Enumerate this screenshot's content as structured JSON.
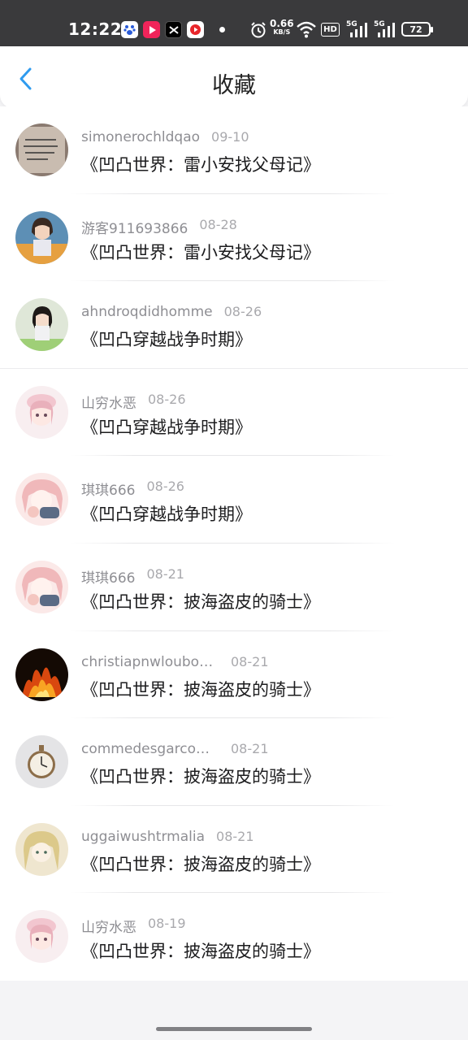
{
  "status_bar": {
    "time": "12:22",
    "net_speed_value": "0.66",
    "net_speed_unit": "KB/S",
    "hd_label": "HD",
    "sim1_label": "5G",
    "sim2_label": "5G",
    "battery": "72"
  },
  "header": {
    "title": "收藏",
    "back_icon": "chevron-left-icon",
    "accent_color": "#2f9bef"
  },
  "favorites": [
    {
      "user": "simonerochldqao",
      "date": "09-10",
      "work": "《凹凸世界：雷小安找父母记》"
    },
    {
      "user": "游客911693866",
      "date": "08-28",
      "work": "《凹凸世界：雷小安找父母记》"
    },
    {
      "user": "ahndroqdidhomme",
      "date": "08-26",
      "work": "《凹凸穿越战争时期》"
    },
    {
      "user": "山穷水恶",
      "date": "08-26",
      "work": "《凹凸穿越战争时期》"
    },
    {
      "user": "琪琪666",
      "date": "08-26",
      "work": "《凹凸穿越战争时期》"
    },
    {
      "user": "琪琪666",
      "date": "08-21",
      "work": "《凹凸世界：披海盗皮的骑士》"
    },
    {
      "user": "christiapnwloubou...",
      "date": "08-21",
      "work": "《凹凸世界：披海盗皮的骑士》"
    },
    {
      "user": "commedesgarcom...",
      "date": "08-21",
      "work": "《凹凸世界：披海盗皮的骑士》"
    },
    {
      "user": "uggaiwushtrmalia",
      "date": "08-21",
      "work": "《凹凸世界：披海盗皮的骑士》"
    },
    {
      "user": "山穷水恶",
      "date": "08-19",
      "work": "《凹凸世界：披海盗皮的骑士》"
    }
  ]
}
